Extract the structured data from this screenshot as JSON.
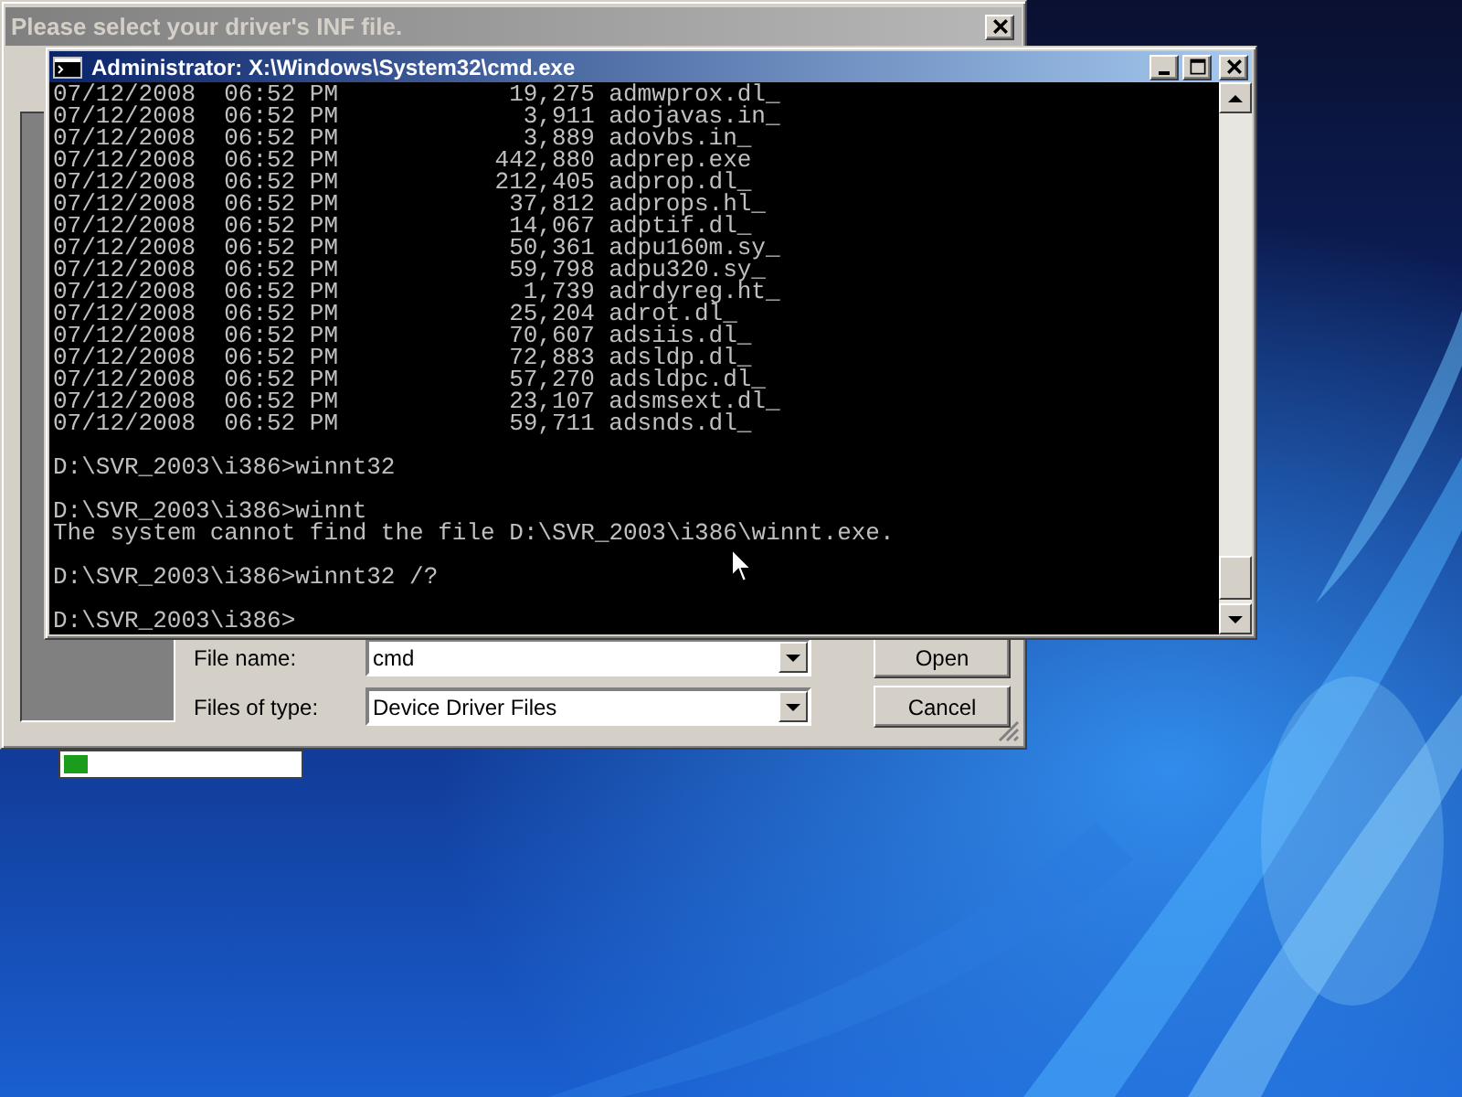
{
  "dialog": {
    "title": "Please select your driver's INF file.",
    "fields": [
      {
        "label": "File name:",
        "value": "cmd"
      },
      {
        "label": "Files of type:",
        "value": "Device Driver Files"
      }
    ],
    "buttons": [
      "Open",
      "Cancel"
    ]
  },
  "console": {
    "title": "Administrator: X:\\Windows\\System32\\cmd.exe",
    "listing": [
      {
        "date": "07/12/2008",
        "time": "06:52 PM",
        "size": "19,275",
        "name": "admwprox.dl_"
      },
      {
        "date": "07/12/2008",
        "time": "06:52 PM",
        "size": "3,911",
        "name": "adojavas.in_"
      },
      {
        "date": "07/12/2008",
        "time": "06:52 PM",
        "size": "3,889",
        "name": "adovbs.in_"
      },
      {
        "date": "07/12/2008",
        "time": "06:52 PM",
        "size": "442,880",
        "name": "adprep.exe"
      },
      {
        "date": "07/12/2008",
        "time": "06:52 PM",
        "size": "212,405",
        "name": "adprop.dl_"
      },
      {
        "date": "07/12/2008",
        "time": "06:52 PM",
        "size": "37,812",
        "name": "adprops.hl_"
      },
      {
        "date": "07/12/2008",
        "time": "06:52 PM",
        "size": "14,067",
        "name": "adptif.dl_"
      },
      {
        "date": "07/12/2008",
        "time": "06:52 PM",
        "size": "50,361",
        "name": "adpu160m.sy_"
      },
      {
        "date": "07/12/2008",
        "time": "06:52 PM",
        "size": "59,798",
        "name": "adpu320.sy_"
      },
      {
        "date": "07/12/2008",
        "time": "06:52 PM",
        "size": "1,739",
        "name": "adrdyreg.ht_"
      },
      {
        "date": "07/12/2008",
        "time": "06:52 PM",
        "size": "25,204",
        "name": "adrot.dl_"
      },
      {
        "date": "07/12/2008",
        "time": "06:52 PM",
        "size": "70,607",
        "name": "adsiis.dl_"
      },
      {
        "date": "07/12/2008",
        "time": "06:52 PM",
        "size": "72,883",
        "name": "adsldp.dl_"
      },
      {
        "date": "07/12/2008",
        "time": "06:52 PM",
        "size": "57,270",
        "name": "adsldpc.dl_"
      },
      {
        "date": "07/12/2008",
        "time": "06:52 PM",
        "size": "23,107",
        "name": "adsmsext.dl_"
      },
      {
        "date": "07/12/2008",
        "time": "06:52 PM",
        "size": "59,711",
        "name": "adsnds.dl_"
      }
    ],
    "blocks": [
      {
        "lines": [
          "D:\\SVR_2003\\i386>winnt32"
        ]
      },
      {
        "lines": [
          "D:\\SVR_2003\\i386>winnt",
          "The system cannot find the file D:\\SVR_2003\\i386\\winnt.exe."
        ]
      },
      {
        "lines": [
          "D:\\SVR_2003\\i386>winnt32 /?"
        ]
      },
      {
        "lines": [
          "D:\\SVR_2003\\i386>"
        ]
      }
    ]
  },
  "progress": {
    "level": 0.1
  }
}
